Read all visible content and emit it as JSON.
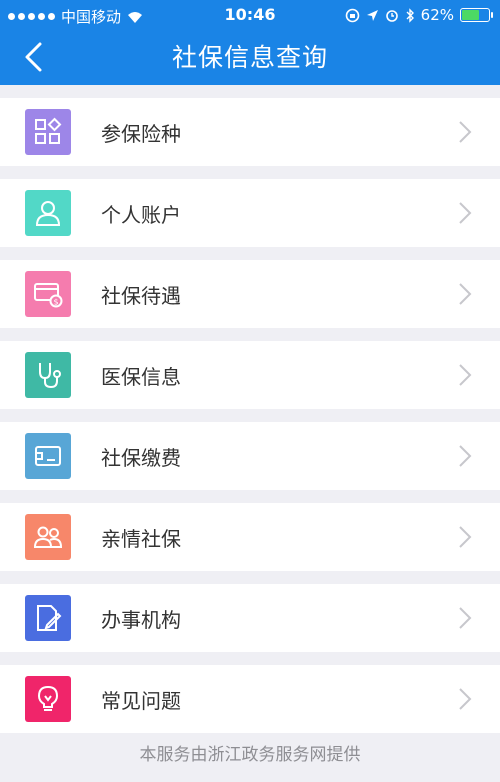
{
  "status_bar": {
    "carrier": "中国移动",
    "time": "10:46",
    "battery": "62%",
    "battery_level": 0.62
  },
  "nav": {
    "title": "社保信息查询",
    "back_icon": "chevron-left-icon"
  },
  "colors": {
    "brand": "#1a84e6",
    "background": "#efeff4"
  },
  "menu": [
    {
      "label": "参保险种",
      "icon": "apps-grid-icon",
      "color": "#9d86e8"
    },
    {
      "label": "个人账户",
      "icon": "user-icon",
      "color": "#52d8c7"
    },
    {
      "label": "社保待遇",
      "icon": "card-dollar-icon",
      "color": "#f57cae"
    },
    {
      "label": "医保信息",
      "icon": "stethoscope-icon",
      "color": "#3fb9a5"
    },
    {
      "label": "社保缴费",
      "icon": "wallet-icon",
      "color": "#58a6d6"
    },
    {
      "label": "亲情社保",
      "icon": "family-icon",
      "color": "#f7876a"
    },
    {
      "label": "办事机构",
      "icon": "document-edit-icon",
      "color": "#4a6de0"
    },
    {
      "label": "常见问题",
      "icon": "lightbulb-icon",
      "color": "#f0256a"
    }
  ],
  "footer": "本服务由浙江政务服务网提供"
}
